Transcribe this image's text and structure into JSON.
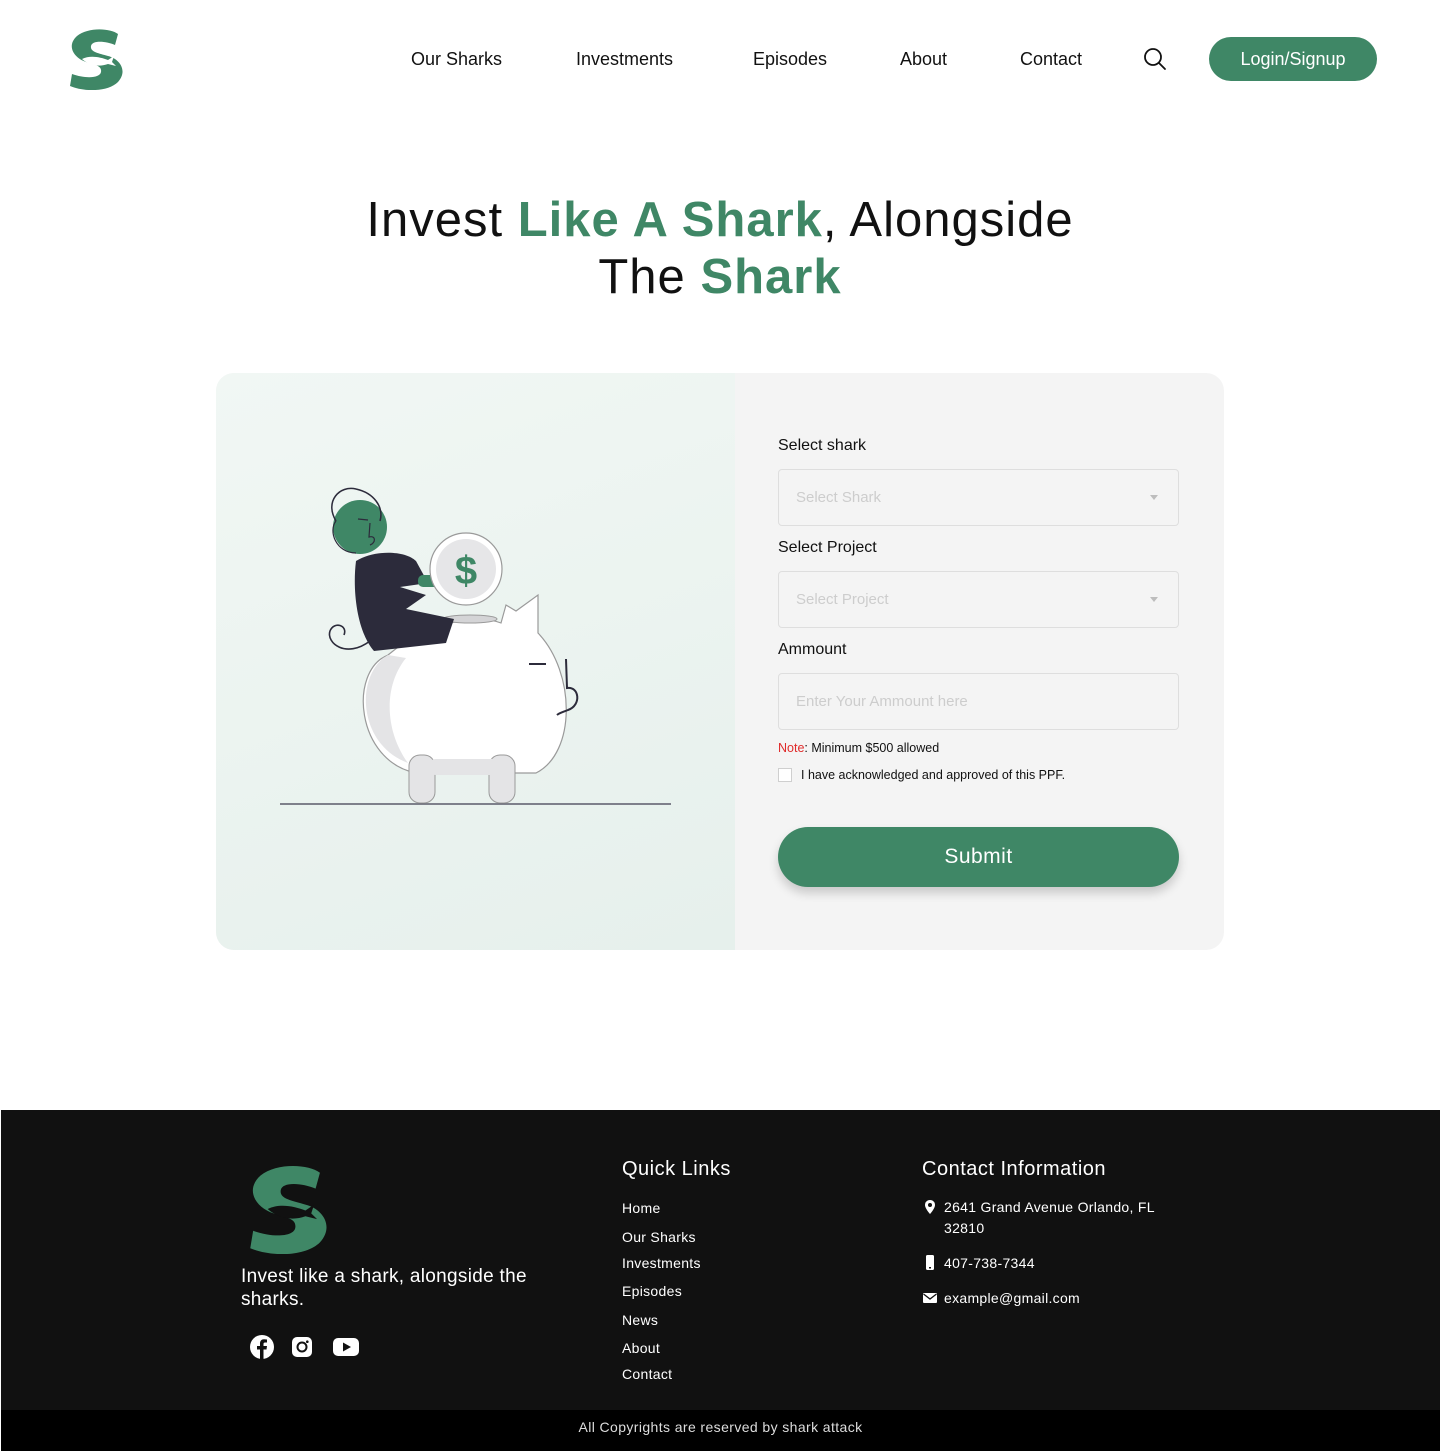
{
  "brand": {
    "color": "#3f8766"
  },
  "nav": {
    "items": [
      "Our Sharks",
      "Investments",
      "Episodes",
      "About",
      "Contact"
    ],
    "search_icon": "search-icon",
    "login_label": "Login/Signup"
  },
  "hero": {
    "part1": "Invest ",
    "part2": "Like A Shark",
    "part3": ", Alongside",
    "part4": "The ",
    "part5": "Shark"
  },
  "form": {
    "shark_label": "Select shark",
    "shark_placeholder": "Select Shark",
    "project_label": "Select Project",
    "project_placeholder": "Select Project",
    "amount_label": "Ammount",
    "amount_placeholder": "Enter Your Ammount here",
    "note_prefix": "Note",
    "note_text": ": Minimum $500 allowed",
    "ack_text": "I have acknowledged and approved of this PPF.",
    "submit_label": "Submit"
  },
  "footer": {
    "tagline": "Invest like a shark, alongside the sharks.",
    "socials": [
      "facebook-icon",
      "instagram-icon",
      "youtube-icon"
    ],
    "quick_links_title": "Quick Links",
    "quick_links": [
      "Home",
      "Our Sharks",
      "Investments",
      "Episodes",
      "News",
      "About",
      "Contact"
    ],
    "contact_title": "Contact Information",
    "address": "2641 Grand Avenue Orlando, FL 32810",
    "phone": "407-738-7344",
    "email": "example@gmail.com",
    "copyright": "All Copyrights are reserved by shark attack"
  }
}
